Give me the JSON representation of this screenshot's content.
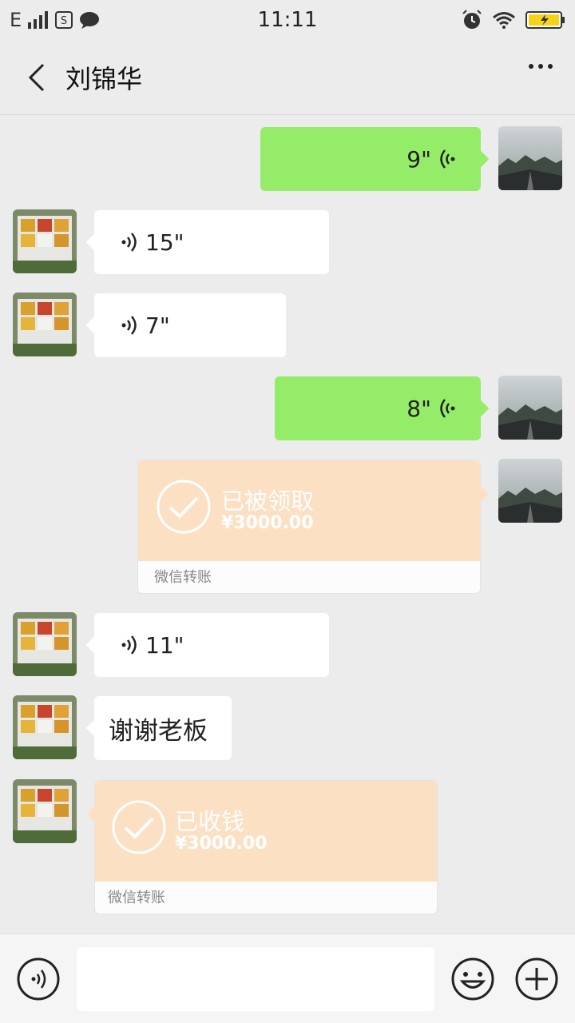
{
  "status_bar": {
    "network": "E",
    "time": "11:11"
  },
  "header": {
    "title": "刘锦华"
  },
  "messages": [
    {
      "side": "right",
      "type": "voice",
      "text": "9\""
    },
    {
      "side": "left",
      "type": "voice",
      "text": "15\""
    },
    {
      "side": "left",
      "type": "voice",
      "text": "7\""
    },
    {
      "side": "right",
      "type": "voice",
      "text": "8\""
    },
    {
      "side": "right",
      "type": "transfer",
      "status": "已被领取",
      "amount": "¥3000.00",
      "footer": "微信转账"
    },
    {
      "side": "left",
      "type": "voice",
      "text": "11\""
    },
    {
      "side": "left",
      "type": "text",
      "text": "谢谢老板"
    },
    {
      "side": "left",
      "type": "transfer",
      "status": "已收钱",
      "amount": "¥3000.00",
      "footer": "微信转账"
    }
  ],
  "colors": {
    "sent_bubble": "#95ec69",
    "received_bubble": "#ffffff",
    "transfer_card": "#fce0c3",
    "background": "#ececec"
  }
}
